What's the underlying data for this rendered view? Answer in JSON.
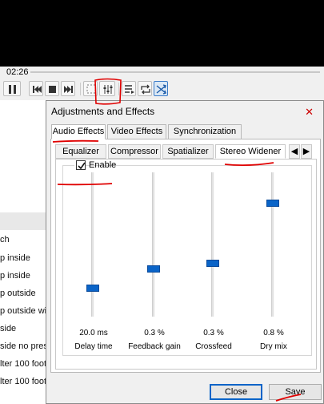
{
  "player": {
    "time": "02:26"
  },
  "controls": [
    {
      "name": "pause-button",
      "icon": "pause-icon"
    },
    {
      "name": "previous-button",
      "icon": "previous-icon"
    },
    {
      "name": "stop-button",
      "icon": "stop-icon"
    },
    {
      "name": "next-button",
      "icon": "next-icon"
    },
    {
      "name": "fullscreen-button",
      "icon": "fullscreen-icon"
    },
    {
      "name": "extended-settings-button",
      "icon": "equalizer-sliders-icon"
    },
    {
      "name": "playlist-button",
      "icon": "playlist-icon"
    },
    {
      "name": "loop-button",
      "icon": "loop-icon"
    },
    {
      "name": "shuffle-button",
      "icon": "shuffle-icon"
    }
  ],
  "playlist": {
    "items": [
      "ch",
      "p inside",
      "p inside",
      "p outside",
      "p outside wi",
      "side",
      "side no pres",
      "lter 100 foot",
      "lter 100 foot"
    ]
  },
  "dialog": {
    "title": "Adjustments and Effects",
    "close": "✕",
    "tabs": [
      "Audio Effects",
      "Video Effects",
      "Synchronization"
    ],
    "active_tab": "Audio Effects",
    "subtabs": [
      "Equalizer",
      "Compressor",
      "Spatializer",
      "Stereo Widener"
    ],
    "active_subtab": "Stereo Widener",
    "enable_label": "Enable",
    "enable_checked": true,
    "sliders": [
      {
        "value": "20.0 ms",
        "label": "Delay time",
        "level": 0.18
      },
      {
        "value": "0.3 %",
        "label": "Feedback gain",
        "level": 0.32
      },
      {
        "value": "0.3 %",
        "label": "Crossfeed",
        "level": 0.36
      },
      {
        "value": "0.8 %",
        "label": "Dry mix",
        "level": 0.8
      }
    ],
    "close_button": "Close",
    "save_button": "Save"
  },
  "colors": {
    "accent": "#0a64c8",
    "annotation": "#e00000"
  }
}
